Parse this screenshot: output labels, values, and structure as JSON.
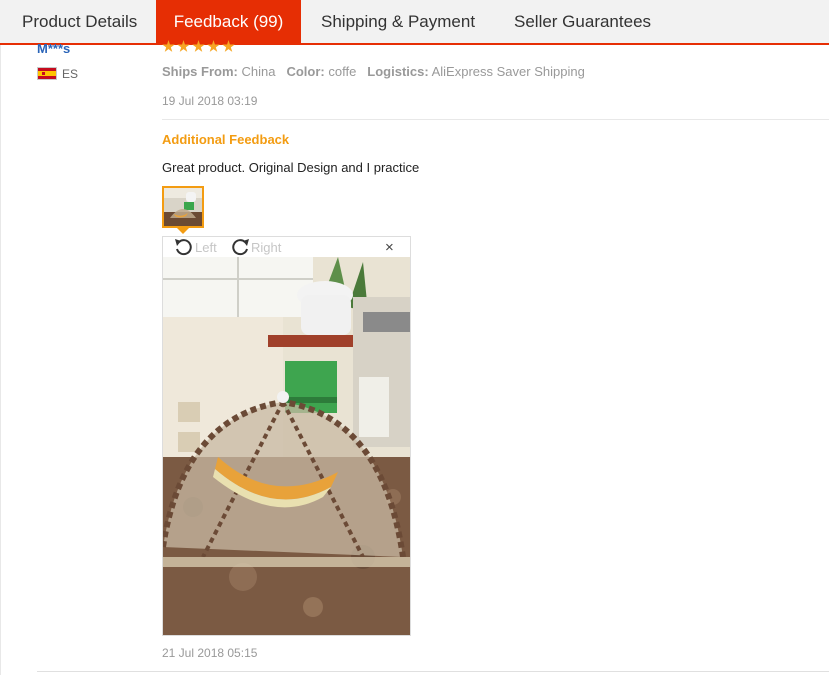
{
  "tabs": {
    "product_details": "Product Details",
    "feedback": "Feedback (99)",
    "shipping": "Shipping & Payment",
    "seller": "Seller Guarantees"
  },
  "review": {
    "user": "M***s",
    "country": "ES",
    "rating_stars": 5,
    "ships_from_label": "Ships From:",
    "ships_from": "China",
    "color_label": "Color:",
    "color": "coffe",
    "logistics_label": "Logistics:",
    "logistics": "AliExpress Saver Shipping",
    "date": "19 Jul 2018 03:19",
    "additional_title": "Additional Feedback",
    "additional_text": "Great product. Original Design and I practice",
    "additional_date": "21 Jul 2018 05:15"
  },
  "viewer": {
    "rotate_left": "Left",
    "rotate_right": "Right",
    "close": "×"
  },
  "colors": {
    "accent": "#e62e04",
    "star": "#f6a623",
    "additional_title": "#f39c12",
    "user_link": "#2a64b8"
  }
}
